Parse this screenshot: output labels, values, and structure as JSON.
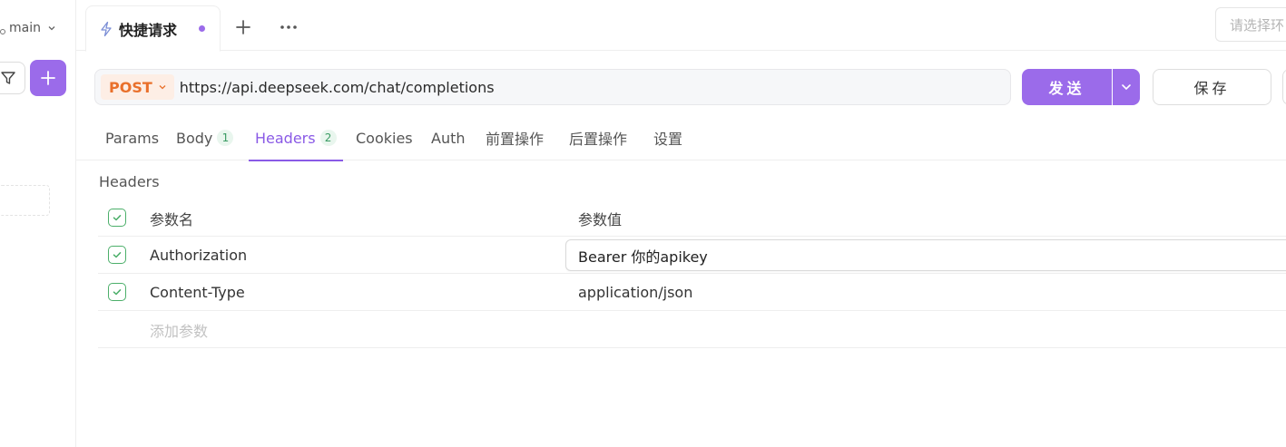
{
  "sidebar": {
    "branch_label": "main"
  },
  "tabs": {
    "active_title": "快捷请求"
  },
  "env": {
    "placeholder": "请选择环"
  },
  "request": {
    "method": "POST",
    "url": "https://api.deepseek.com/chat/completions",
    "send_label": "发送",
    "save_label": "保存"
  },
  "req_tabs": [
    {
      "label": "Params",
      "badge": ""
    },
    {
      "label": "Body",
      "badge": "1"
    },
    {
      "label": "Headers",
      "badge": "2"
    },
    {
      "label": "Cookies",
      "badge": ""
    },
    {
      "label": "Auth",
      "badge": ""
    },
    {
      "label": "前置操作",
      "badge": ""
    },
    {
      "label": "后置操作",
      "badge": ""
    },
    {
      "label": "设置",
      "badge": ""
    }
  ],
  "headers_section": {
    "title": "Headers",
    "col_name": "参数名",
    "col_value": "参数值",
    "rows": [
      {
        "name": "Authorization",
        "value": "Bearer 你的apikey",
        "enabled": true
      },
      {
        "name": "Content-Type",
        "value": "application/json",
        "enabled": true
      }
    ],
    "add_placeholder": "添加参数"
  },
  "colors": {
    "accent": "#9b6bea",
    "method_post": "#e9702b",
    "check_green": "#4caf6a"
  }
}
